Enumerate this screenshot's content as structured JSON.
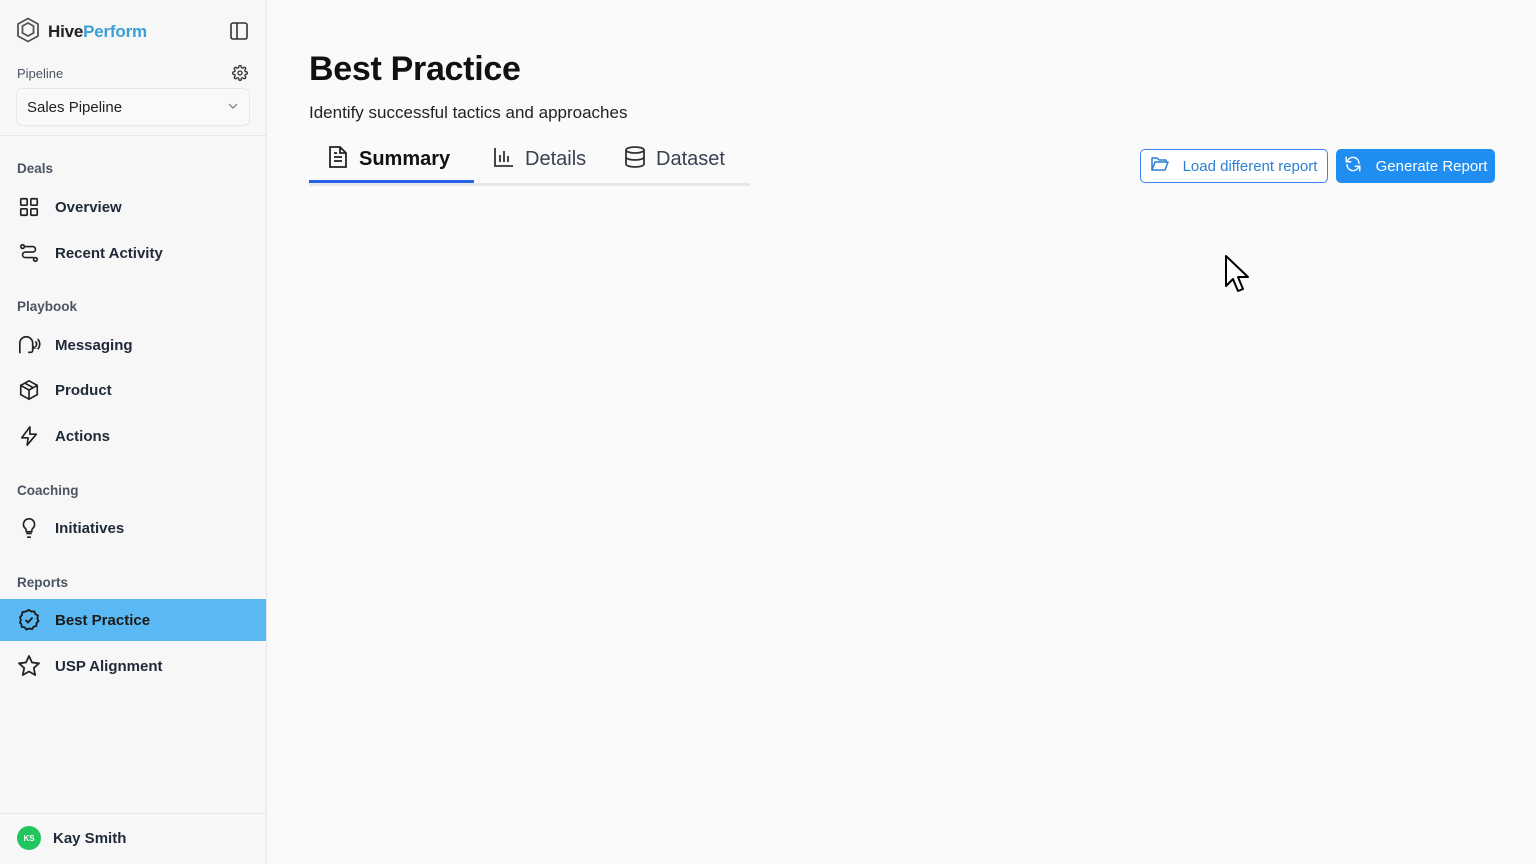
{
  "brand": {
    "name_part1": "Hive",
    "name_part2": "Perform",
    "accent": "#3b9fd8"
  },
  "pipeline": {
    "label": "Pipeline",
    "selected": "Sales Pipeline"
  },
  "sections": {
    "deals": "Deals",
    "playbook": "Playbook",
    "coaching": "Coaching",
    "reports": "Reports"
  },
  "nav": {
    "overview": "Overview",
    "recent_activity": "Recent Activity",
    "messaging": "Messaging",
    "product": "Product",
    "actions": "Actions",
    "initiatives": "Initiatives",
    "best_practice": "Best Practice",
    "usp_alignment": "USP Alignment"
  },
  "user": {
    "initials": "KS",
    "name": "Kay Smith"
  },
  "page": {
    "title": "Best Practice",
    "subtitle": "Identify successful tactics and approaches"
  },
  "tabs": {
    "summary": "Summary",
    "details": "Details",
    "dataset": "Dataset",
    "active": "Summary"
  },
  "actions": {
    "load_report": "Load different report",
    "generate_report": "Generate Report"
  },
  "colors": {
    "active_nav": "#5ab8f2",
    "primary_button": "#1f8ef0",
    "tab_underline": "#2563eb",
    "avatar": "#22c55e"
  }
}
